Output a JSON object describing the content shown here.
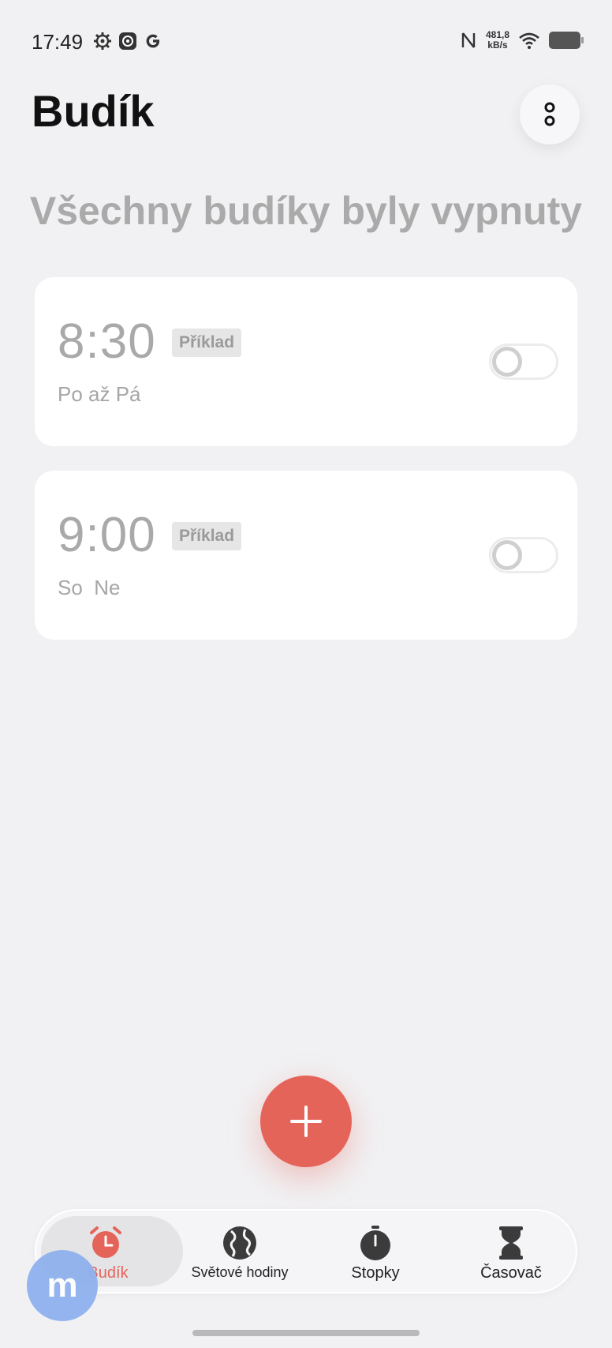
{
  "status_bar": {
    "time": "17:49",
    "net_speed_value": "481,8",
    "net_speed_unit": "kB/s",
    "left_icons": [
      "gear-icon",
      "settings-app-icon",
      "google-icon"
    ],
    "right_icons": [
      "nfc-icon",
      "wifi-icon",
      "battery-icon"
    ]
  },
  "header": {
    "title": "Budík"
  },
  "headline": "Všechny budíky byly vypnuty",
  "alarms": [
    {
      "time": "8:30",
      "badge": "Příklad",
      "days": "Po až Pá",
      "enabled": false
    },
    {
      "time": "9:00",
      "badge": "Příklad",
      "days": "So  Ne",
      "enabled": false
    }
  ],
  "bottom_nav": {
    "items": [
      {
        "label": "Budík",
        "icon": "alarm-clock-icon",
        "active": true
      },
      {
        "label": "Světové hodiny",
        "icon": "globe-icon",
        "active": false
      },
      {
        "label": "Stopky",
        "icon": "stopwatch-icon",
        "active": false
      },
      {
        "label": "Časovač",
        "icon": "hourglass-icon",
        "active": false
      }
    ]
  },
  "watermark": {
    "letter": "m"
  },
  "colors": {
    "accent": "#e5645a",
    "background": "#f1f1f3",
    "card": "#ffffff",
    "muted_text": "#a9a9a9"
  }
}
